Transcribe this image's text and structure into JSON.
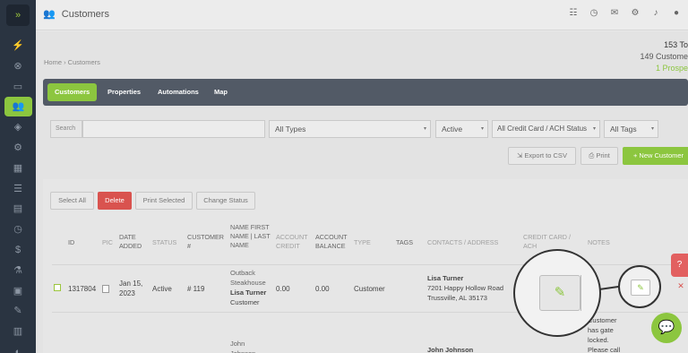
{
  "app": {
    "title": "Customers",
    "logo_glyph": "»",
    "accent": "#8cc63f"
  },
  "sidebar": {
    "items": [
      {
        "icon": "sales-icon",
        "glyph": "⚡"
      },
      {
        "icon": "support-icon",
        "glyph": "⊗"
      },
      {
        "icon": "monitor-icon",
        "glyph": "▭"
      },
      {
        "icon": "customers-icon",
        "glyph": "👥"
      },
      {
        "icon": "box-icon",
        "glyph": "◈"
      },
      {
        "icon": "settings-icon",
        "glyph": "⚙"
      },
      {
        "icon": "calendar-icon",
        "glyph": "▦"
      },
      {
        "icon": "list-icon",
        "glyph": "☰"
      },
      {
        "icon": "clipboard-icon",
        "glyph": "▤"
      },
      {
        "icon": "clock-icon",
        "glyph": "◷"
      },
      {
        "icon": "dollar-icon",
        "glyph": "$"
      },
      {
        "icon": "flask-icon",
        "glyph": "⚗"
      },
      {
        "icon": "document-icon",
        "glyph": "▣"
      },
      {
        "icon": "edit-doc-icon",
        "glyph": "✎"
      },
      {
        "icon": "chart-icon",
        "glyph": "▥"
      },
      {
        "icon": "handshake-icon",
        "glyph": "◐"
      }
    ]
  },
  "topbar": {
    "icons": [
      {
        "name": "filter-list-icon",
        "glyph": "☷"
      },
      {
        "name": "history-icon",
        "glyph": "◷"
      },
      {
        "name": "chat-icon",
        "glyph": "✉"
      },
      {
        "name": "gear-icon",
        "glyph": "⚙"
      },
      {
        "name": "bell-icon",
        "glyph": "♪"
      },
      {
        "name": "user-icon",
        "glyph": "●"
      }
    ]
  },
  "breadcrumb": "Home › Customers",
  "summary": {
    "total": "153 To",
    "customers": "149 Custome",
    "prospects": "1 Prospe"
  },
  "tabs": [
    {
      "label": "Customers",
      "active": true
    },
    {
      "label": "Properties",
      "active": false
    },
    {
      "label": "Automations",
      "active": false
    },
    {
      "label": "Map",
      "active": false
    }
  ],
  "filters": {
    "search_label": "Search",
    "search_value": "",
    "types": "All Types",
    "status": "Active",
    "credit_card": "All Credit Card / ACH Status",
    "tags": "All Tags"
  },
  "actions": {
    "export_csv": "Export to CSV",
    "print": "Print",
    "new_customer": "+ New Customer"
  },
  "bulk": {
    "select_all": "Select All",
    "delete": "Delete",
    "print_selected": "Print Selected",
    "change_status": "Change Status"
  },
  "table": {
    "headers": {
      "id": "ID",
      "pic": "PIC",
      "date_added": "DATE ADDED",
      "status": "STATUS",
      "customer_no": "CUSTOMER #",
      "name": "NAME FIRST NAME | LAST NAME",
      "account_credit": "ACCOUNT CREDIT",
      "account_balance": "ACCOUNT BALANCE",
      "type": "TYPE",
      "tags": "TAGS",
      "contacts": "CONTACTS / ADDRESS",
      "credit_card": "CREDIT CARD / ACH",
      "notes": "NOTES"
    },
    "rows": [
      {
        "id": "1317804",
        "date_added": "Jan 15, 2023",
        "status": "Active",
        "customer_no": "# 119",
        "company": "Outback Steakhouse",
        "contact_name": "Lisa Turner",
        "contact_type": "Customer",
        "account_credit": "0.00",
        "account_balance": "0.00",
        "type": "Customer",
        "address_name": "Lisa Turner",
        "address_line1": "7201 Happy Hollow Road",
        "address_line2": "Trussville, AL 35173",
        "notes": ""
      },
      {
        "name_partial": "John Johnson",
        "address_name": "John Johnson",
        "notes": "Customer has gate locked. Please call"
      }
    ]
  },
  "floating": {
    "help_glyph": "?",
    "close_glyph": "✕",
    "chat_glyph": "💬",
    "edit_glyph": "✎"
  }
}
